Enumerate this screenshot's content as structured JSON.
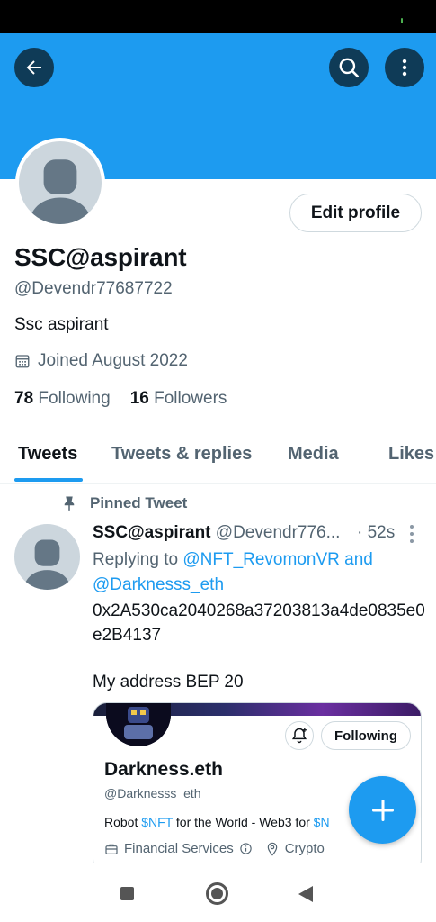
{
  "profile": {
    "display_name": "SSC@aspirant",
    "handle": "@Devendr77687722",
    "bio": "Ssc aspirant",
    "joined": "Joined August 2022",
    "following_count": "78",
    "following_label": "Following",
    "followers_count": "16",
    "followers_label": "Followers",
    "edit_profile_label": "Edit profile"
  },
  "tabs": [
    {
      "label": "Tweets",
      "active": true
    },
    {
      "label": "Tweets & replies"
    },
    {
      "label": "Media"
    },
    {
      "label": "Likes"
    }
  ],
  "pinned_tweet": {
    "pinned_label": "Pinned Tweet",
    "author_name": "SSC@aspirant",
    "author_handle": "@Devendr776...",
    "time": "· 52s",
    "replying_prefix": "Replying to",
    "reply_to_1": "@NFT_RevomonVR",
    "reply_and": "and",
    "reply_to_2": "@Darknesss_eth",
    "body_line1": "0x2A530ca2040268a37203813a4de0835e0e2B4137",
    "body_line2": "My address BEP 20"
  },
  "profile_card": {
    "name": "Darkness.eth",
    "handle": "@Darknesss_eth",
    "bio_prefix": "Robot ",
    "bio_tag1": "$NFT",
    "bio_middle": " for the World - Web3 for ",
    "bio_tag2": "$N",
    "following_label": "Following",
    "category": "Financial Services",
    "location": "Crypto"
  },
  "colors": {
    "accent": "#1d9bf0",
    "banner": "#1d9bf0",
    "header_button": "#0f3b57",
    "secondary_text": "#536471"
  },
  "icons": [
    "back-arrow-icon",
    "search-icon",
    "more-vertical-icon",
    "calendar-icon",
    "pin-icon",
    "bell-plus-icon",
    "briefcase-icon",
    "info-icon",
    "location-pin-icon",
    "plus-icon"
  ]
}
